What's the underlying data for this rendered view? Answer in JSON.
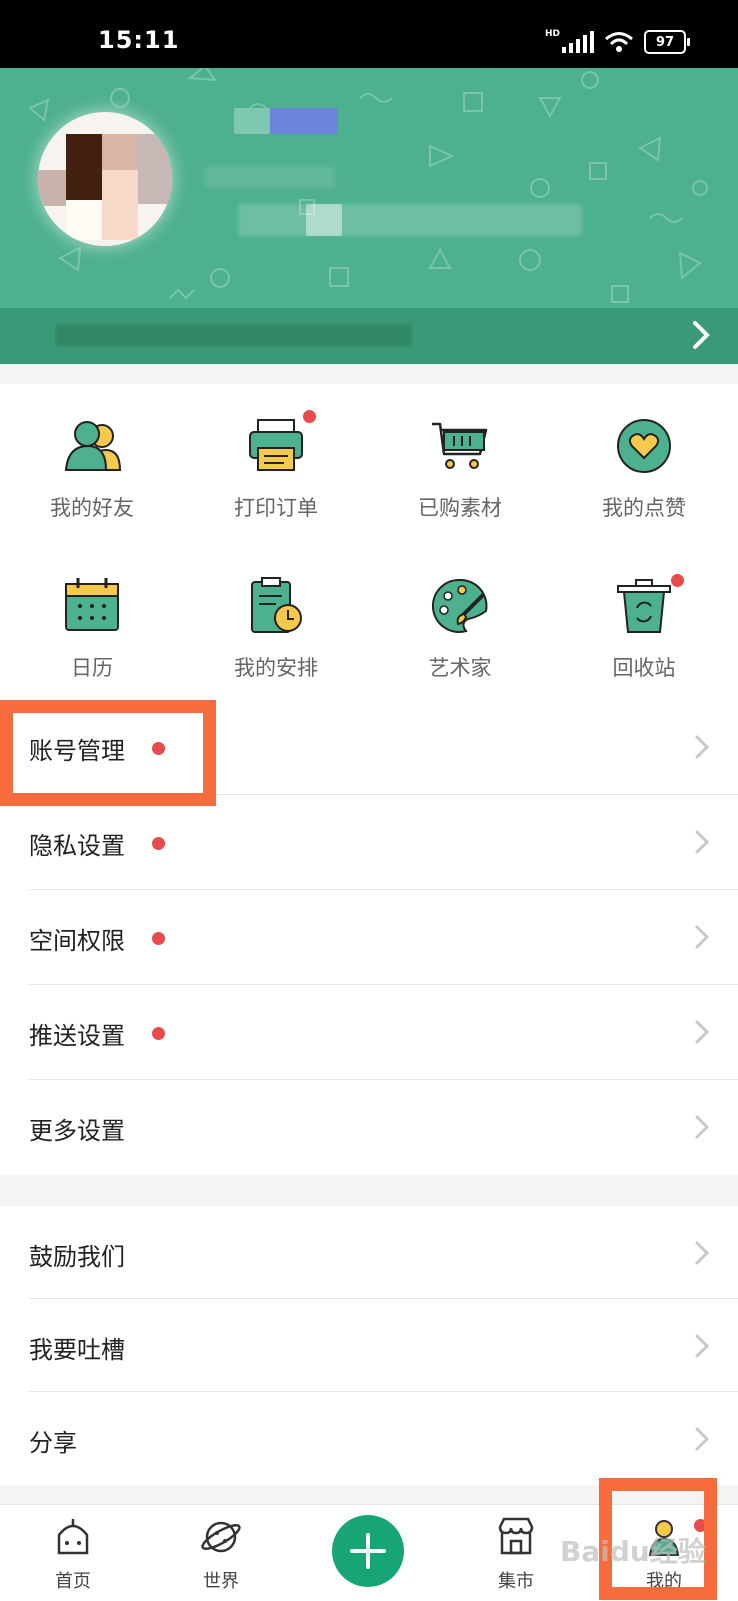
{
  "status": {
    "time": "15:11",
    "network": "HD",
    "battery": "97"
  },
  "grid": [
    {
      "label": "我的好友",
      "icon": "friends-icon",
      "badge": false
    },
    {
      "label": "打印订单",
      "icon": "printer-icon",
      "badge": true
    },
    {
      "label": "已购素材",
      "icon": "cart-icon",
      "badge": false
    },
    {
      "label": "我的点赞",
      "icon": "heart-icon",
      "badge": false
    },
    {
      "label": "日历",
      "icon": "calendar-icon",
      "badge": false
    },
    {
      "label": "我的安排",
      "icon": "schedule-icon",
      "badge": false
    },
    {
      "label": "艺术家",
      "icon": "palette-icon",
      "badge": false
    },
    {
      "label": "回收站",
      "icon": "trash-icon",
      "badge": true
    }
  ],
  "settings": [
    {
      "label": "账号管理",
      "badge": true
    },
    {
      "label": "隐私设置",
      "badge": true
    },
    {
      "label": "空间权限",
      "badge": true
    },
    {
      "label": "推送设置",
      "badge": true
    },
    {
      "label": "更多设置",
      "badge": false
    }
  ],
  "more": [
    {
      "label": "鼓励我们"
    },
    {
      "label": "我要吐槽"
    },
    {
      "label": "分享"
    }
  ],
  "tabs": [
    {
      "label": "首页",
      "icon": "home-icon"
    },
    {
      "label": "世界",
      "icon": "planet-icon"
    },
    {
      "label": "集市",
      "icon": "store-icon"
    },
    {
      "label": "我的",
      "icon": "profile-icon"
    }
  ],
  "colors": {
    "accent": "#4db08e",
    "badge": "#e84b4b",
    "highlight": "#f76c3c",
    "add": "#17a673"
  },
  "watermark": "Baidu经验"
}
